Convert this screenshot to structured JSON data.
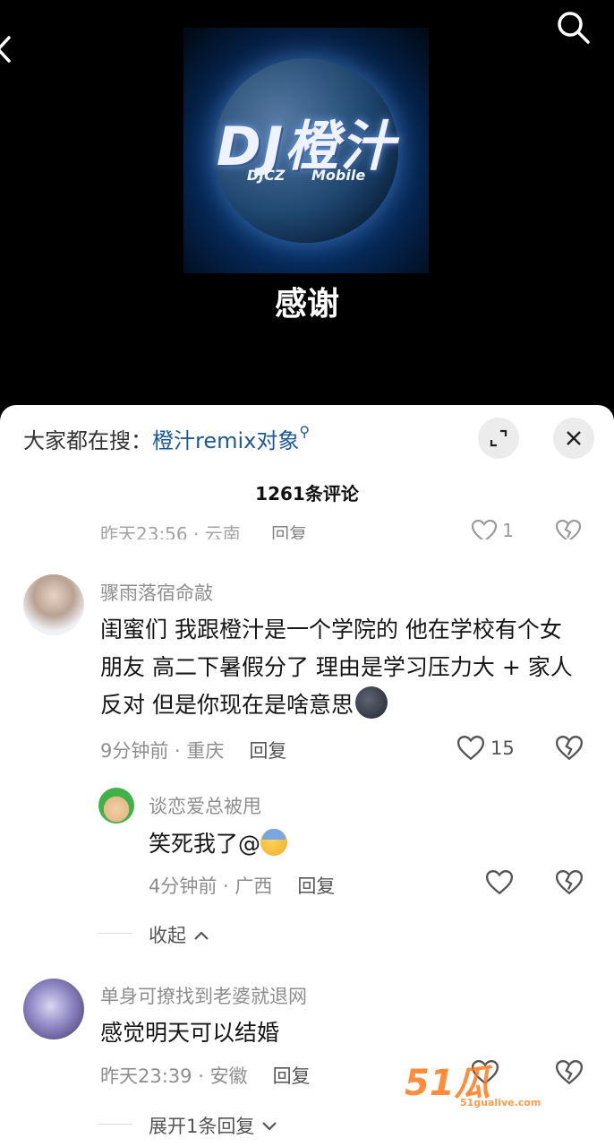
{
  "player": {
    "cover_logo_main": "DJ橙汁",
    "cover_logo_sub": "DJCZ Mobile",
    "song_title": "感谢"
  },
  "sheet": {
    "search_prefix": "大家都在搜：",
    "search_hot": "橙汁remix对象",
    "comment_count": "1261条评论"
  },
  "ghost_row": {
    "meta": "昨天23:56 · 云南",
    "reply": "回复",
    "likes": "1"
  },
  "comments": [
    {
      "user": "骤雨落宿命敲",
      "text": "闺蜜们 我跟橙汁是一个学院的 他在学校有个女朋友 高二下暑假分了 理由是学习压力大 + 家人反对 但是你现在是啥意思",
      "time": "9分钟前",
      "location": "重庆",
      "reply": "回复",
      "likes": "15"
    },
    {
      "user": "谈恋爱总被甩",
      "text": "笑死我了@",
      "time": "4分钟前",
      "location": "广西",
      "reply": "回复",
      "likes": ""
    },
    {
      "user": "单身可撩找到老婆就退网",
      "text": "感觉明天可以结婚",
      "time": "昨天23:39",
      "location": "安徽",
      "reply": "回复",
      "likes": ""
    }
  ],
  "threads": {
    "collapse": "收起",
    "expand": "展开1条回复"
  },
  "watermark": {
    "brand": "51瓜",
    "site": "51gualive.com"
  },
  "icons": {
    "back": "chevron-left-icon",
    "search": "search-icon",
    "expand": "expand-icon",
    "close": "close-icon",
    "like": "heart-icon",
    "dislike": "broken-heart-icon"
  }
}
